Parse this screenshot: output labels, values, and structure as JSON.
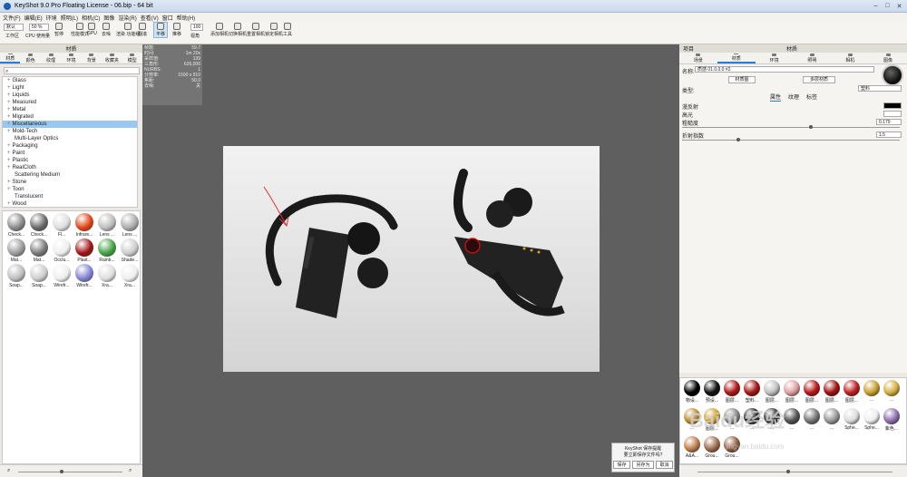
{
  "window": {
    "title": "KeyShot 9.0 Pro Floating License  -  06.bip  -  64 bit"
  },
  "menu": [
    "文件(F)",
    "编辑(E)",
    "环境",
    "照明(L)",
    "相机(C)",
    "图像",
    "渲染(R)",
    "查看(V)",
    "窗口",
    "帮助(H)"
  ],
  "toolbar": {
    "workspace_dd": "默认",
    "zoom_dd": "50 %",
    "render_value": "100",
    "items": [
      "工作区",
      "CPU 使用量",
      "暂停",
      "性能模式",
      "GPU",
      "去噪",
      "渲染 功能组",
      "翻滚",
      "平移",
      "推移",
      "视角",
      "添加相机",
      "切换相机",
      "重置相机",
      "锁定相机",
      "工具"
    ]
  },
  "left": {
    "header": "材质",
    "tabs": [
      "材质",
      "颜色",
      "纹理",
      "环境",
      "背景",
      "收藏夹",
      "模型"
    ],
    "tree": [
      {
        "label": "Glass",
        "plus": true
      },
      {
        "label": "Light",
        "plus": true
      },
      {
        "label": "Liquids",
        "plus": true
      },
      {
        "label": "Measured",
        "plus": true
      },
      {
        "label": "Metal",
        "plus": true
      },
      {
        "label": "Migrated",
        "plus": true
      },
      {
        "label": "Miscellaneous",
        "plus": true
      },
      {
        "label": "Mold-Tech",
        "plus": true
      },
      {
        "label": "Multi-Layer Optics",
        "plus": false
      },
      {
        "label": "Packaging",
        "plus": true
      },
      {
        "label": "Paint",
        "plus": true
      },
      {
        "label": "Plastic",
        "plus": true
      },
      {
        "label": "RealCloth",
        "plus": true
      },
      {
        "label": "Scattering Medium",
        "plus": false
      },
      {
        "label": "Stone",
        "plus": true
      },
      {
        "label": "Toon",
        "plus": true
      },
      {
        "label": "Translucent",
        "plus": false
      },
      {
        "label": "Wood",
        "plus": true
      }
    ],
    "selected": "Miscellaneous",
    "thumbs": [
      {
        "label": "Check...",
        "color": "#888"
      },
      {
        "label": "Check...",
        "color": "#666"
      },
      {
        "label": "Fl...",
        "color": "#ddd"
      },
      {
        "label": "Infrare...",
        "color": "#e04010"
      },
      {
        "label": "Lens ...",
        "color": "#bbb"
      },
      {
        "label": "Lens ...",
        "color": "#aaa"
      },
      {
        "label": "Mat...",
        "color": "#999"
      },
      {
        "label": "Mat...",
        "color": "#777"
      },
      {
        "label": "Occlu...",
        "color": "#eee"
      },
      {
        "label": "Plast...",
        "color": "#a01010"
      },
      {
        "label": "Rainb...",
        "color": "#40a040"
      },
      {
        "label": "Shade...",
        "color": "#ccc"
      },
      {
        "label": "Soap...",
        "color": "#bbb"
      },
      {
        "label": "Soap...",
        "color": "#ccc"
      },
      {
        "label": "Wirefr...",
        "color": "#eee"
      },
      {
        "label": "Wirefr...",
        "color": "#8080d0"
      },
      {
        "label": "Xra...",
        "color": "#ddd"
      },
      {
        "label": "Xra...",
        "color": "#eee"
      }
    ]
  },
  "hud": [
    {
      "k": "帧数:",
      "v": "59.7"
    },
    {
      "k": "时间:",
      "v": "1m 20s"
    },
    {
      "k": "采样值:",
      "v": "139"
    },
    {
      "k": "三角形:",
      "v": "626,006"
    },
    {
      "k": "NURBS:",
      "v": "1"
    },
    {
      "k": "分辨率:",
      "v": "1500 x 910"
    },
    {
      "k": "焦距:",
      "v": "50.0"
    },
    {
      "k": "去噪:",
      "v": "关"
    }
  ],
  "dialog": {
    "title": "KeyShot 保存提醒",
    "message": "要立即保存文件吗?",
    "buttons": [
      "保存",
      "另存为",
      "取消"
    ]
  },
  "right": {
    "header_left": "项目",
    "header": "材质",
    "tabs": [
      "场景",
      "材质",
      "环境",
      "照明",
      "相机",
      "图像"
    ],
    "name_label": "名称:",
    "name_value": "质感 01.0.0.0 #2",
    "graph_btn": "材质图",
    "multi_btn": "多层材质",
    "type_label": "类型:",
    "type_value": "塑料",
    "subtabs": [
      "属性",
      "纹理",
      "标签"
    ],
    "props": [
      {
        "label": "漫反射",
        "value": ""
      },
      {
        "label": "高光",
        "value": ""
      },
      {
        "label": "粗糙度",
        "value": "0.179"
      },
      {
        "label": "折射指数",
        "value": "1.5"
      }
    ],
    "swatches": [
      {
        "label": "物设...",
        "color": "#000"
      },
      {
        "label": "预设...",
        "color": "#111"
      },
      {
        "label": "图层...",
        "color": "#b01818"
      },
      {
        "label": "塑料...",
        "color": "#a81616"
      },
      {
        "label": "图层...",
        "color": "#c0c0c0"
      },
      {
        "label": "图层...",
        "color": "#e0a0a0"
      },
      {
        "label": "图层...",
        "color": "#b81818"
      },
      {
        "label": "图层...",
        "color": "#a01010"
      },
      {
        "label": "图层...",
        "color": "#c02020"
      },
      {
        "label": "...",
        "color": "#c8a030"
      },
      {
        "label": "...",
        "color": "#d4b040"
      },
      {
        "label": "...",
        "color": "#c09030"
      },
      {
        "label": "图层...",
        "color": "#d0a030"
      },
      {
        "label": "...",
        "color": "#888"
      },
      {
        "label": "...",
        "color": "#222"
      },
      {
        "label": "...",
        "color": "#333"
      },
      {
        "label": "...",
        "color": "#555"
      },
      {
        "label": "...",
        "color": "#777"
      },
      {
        "label": "...",
        "color": "#999"
      },
      {
        "label": "Sphe...",
        "color": "#ddd"
      },
      {
        "label": "Sphe...",
        "color": "#eee"
      },
      {
        "label": "紫色...",
        "color": "#9070b0"
      },
      {
        "label": "A&A...",
        "color": "#c08050"
      },
      {
        "label": "Grou...",
        "color": "#a07050"
      },
      {
        "label": "Grou...",
        "color": "#906040"
      }
    ]
  },
  "watermark": {
    "main": "Baidu经验",
    "sub": "jingyan.baidu.com"
  }
}
